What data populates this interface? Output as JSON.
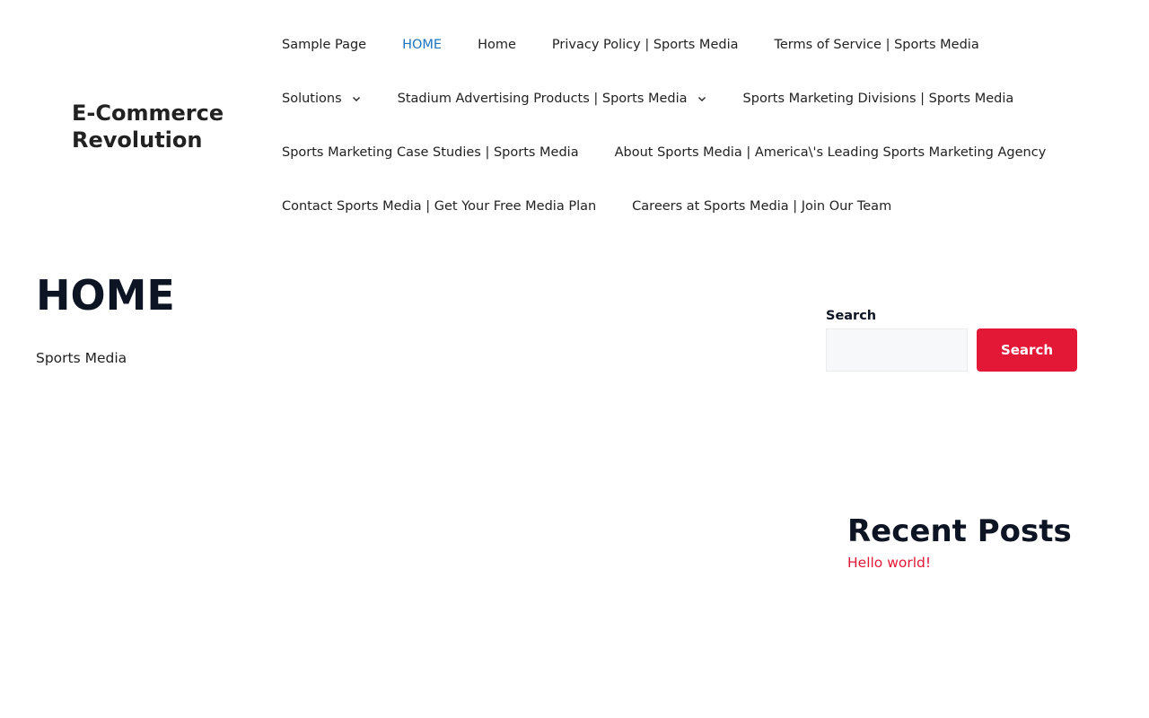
{
  "site": {
    "title": "E-Commerce Revolution"
  },
  "nav": {
    "items": [
      {
        "label": "Sample Page",
        "active": false,
        "has_dropdown": false
      },
      {
        "label": "HOME",
        "active": true,
        "has_dropdown": false
      },
      {
        "label": "Home",
        "active": false,
        "has_dropdown": false
      },
      {
        "label": "Privacy Policy | Sports Media",
        "active": false,
        "has_dropdown": false
      },
      {
        "label": "Terms of Service | Sports Media",
        "active": false,
        "has_dropdown": false
      },
      {
        "label": "Solutions",
        "active": false,
        "has_dropdown": true
      },
      {
        "label": "Stadium Advertising Products | Sports Media",
        "active": false,
        "has_dropdown": true
      },
      {
        "label": "Sports Marketing Divisions | Sports Media",
        "active": false,
        "has_dropdown": false
      },
      {
        "label": "Sports Marketing Case Studies | Sports Media",
        "active": false,
        "has_dropdown": false
      },
      {
        "label": "About Sports Media | America\\'s Leading Sports Marketing Agency",
        "active": false,
        "has_dropdown": false
      },
      {
        "label": "Contact Sports Media | Get Your Free Media Plan",
        "active": false,
        "has_dropdown": false
      },
      {
        "label": "Careers at Sports Media | Join Our Team",
        "active": false,
        "has_dropdown": false
      }
    ]
  },
  "main": {
    "title": "HOME",
    "content": "Sports Media"
  },
  "sidebar": {
    "search": {
      "label": "Search",
      "value": "",
      "placeholder": "",
      "button_label": "Search"
    },
    "recent_posts": {
      "title": "Recent Posts",
      "posts": [
        "Hello world!"
      ]
    }
  },
  "colors": {
    "accent": "#e31837",
    "active_link": "#1e73be",
    "heading": "#0d1424",
    "text": "#222222"
  },
  "icons": {
    "dropdown": "chevron-down-icon"
  }
}
